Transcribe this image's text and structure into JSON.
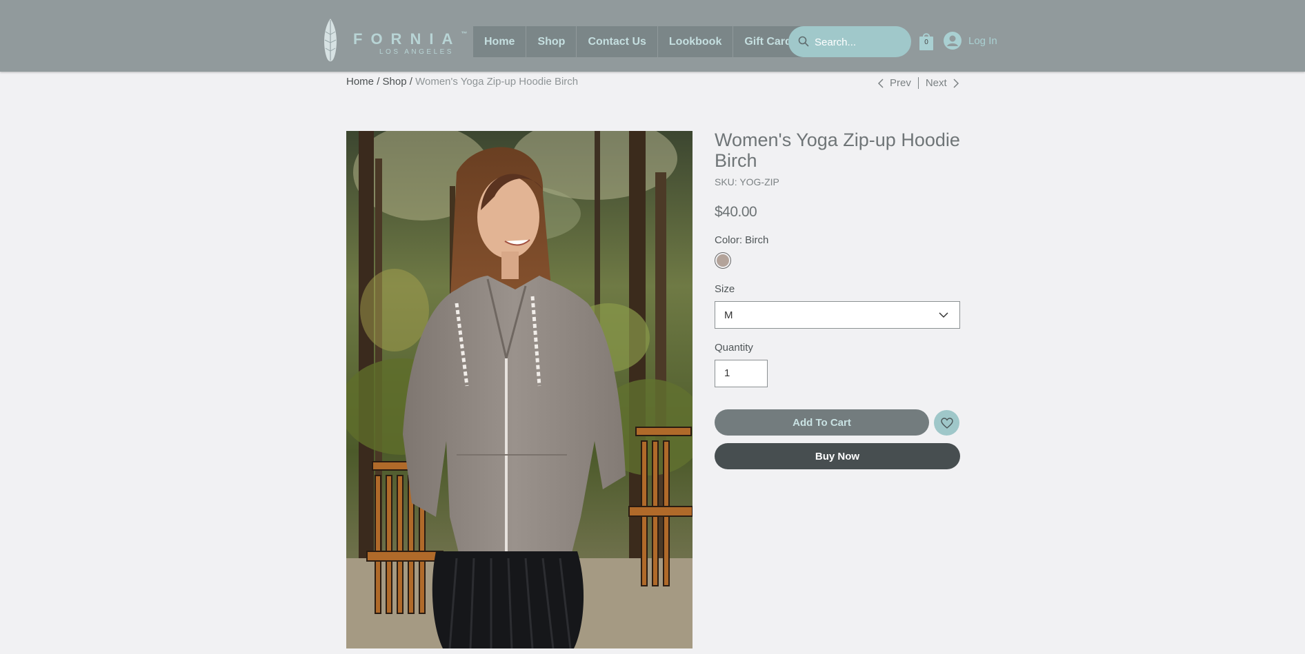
{
  "brand": {
    "name": "FORNIA",
    "trademark": "™",
    "tagline": "LOS ANGELES"
  },
  "nav": {
    "items": [
      {
        "label": "Home"
      },
      {
        "label": "Shop"
      },
      {
        "label": "Contact Us"
      },
      {
        "label": "Lookbook"
      },
      {
        "label": "Gift Card"
      }
    ]
  },
  "search": {
    "placeholder": "Search..."
  },
  "cart": {
    "count": "0",
    "icon": "shopping-bag-icon"
  },
  "account": {
    "login_label": "Log In",
    "icon": "user-avatar-icon"
  },
  "breadcrumb": {
    "home": "Home",
    "separator": "/",
    "shop": "Shop",
    "current": "Women's Yoga Zip-up Hoodie Birch"
  },
  "pager": {
    "prev_label": "Prev",
    "next_label": "Next"
  },
  "product": {
    "image_alt": "Woman wearing a grey zip-up hoodie and black pleated skirt outdoors among pine trees",
    "title": "Women's Yoga Zip-up Hoodie Birch",
    "sku": "SKU: YOG-ZIP",
    "price": "$40.00",
    "color_label": "Color: Birch",
    "swatch_color": "#b3a39a",
    "size_label": "Size",
    "size_value": "M",
    "quantity_label": "Quantity",
    "quantity_value": "1",
    "add_to_cart_label": "Add To Cart",
    "buy_now_label": "Buy Now",
    "wishlist_icon": "heart-icon"
  },
  "colors": {
    "header_bg": "#919a9c",
    "accent": "#9fc7c9",
    "nav_bg": "#7b8688",
    "buy_now_bg": "#474e50"
  }
}
